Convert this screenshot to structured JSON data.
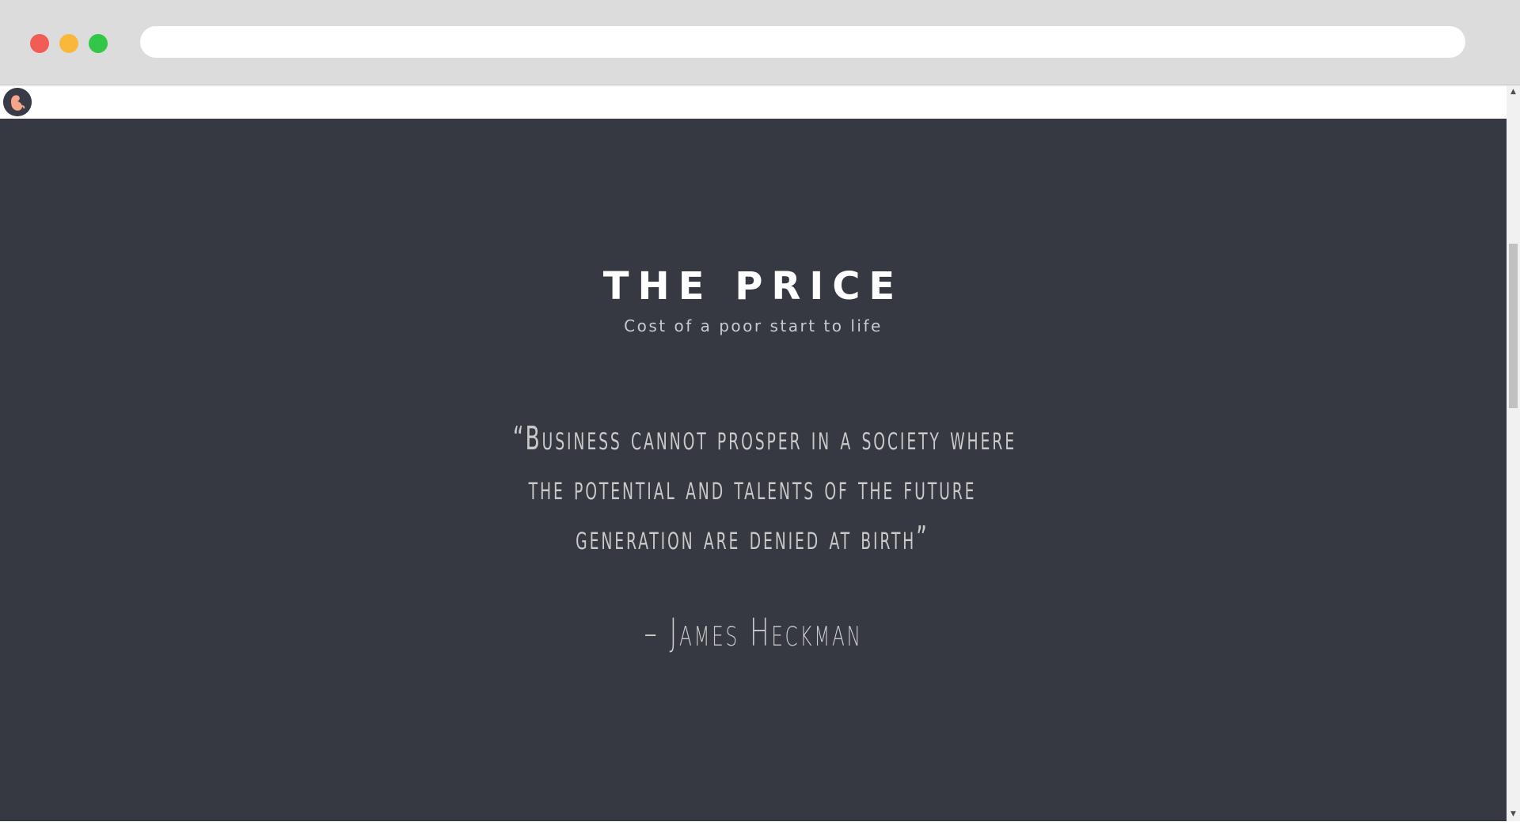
{
  "browser": {
    "address_value": "",
    "buttons": [
      "close",
      "minimize",
      "maximize"
    ]
  },
  "site": {
    "logo_icon": "fetus-icon"
  },
  "section": {
    "title": "THE PRICE",
    "subtitle": "Cost of a poor start to life",
    "quote_lines": [
      "“Business cannot prosper in a society where",
      "the potential and talents of the future",
      "generation are denied at birth”"
    ],
    "author": "– James Heckman"
  },
  "colors": {
    "section_bg": "#363842",
    "title": "#ffffff",
    "text_muted": "#c9c9c9",
    "logo_accent": "#f4a58a"
  }
}
